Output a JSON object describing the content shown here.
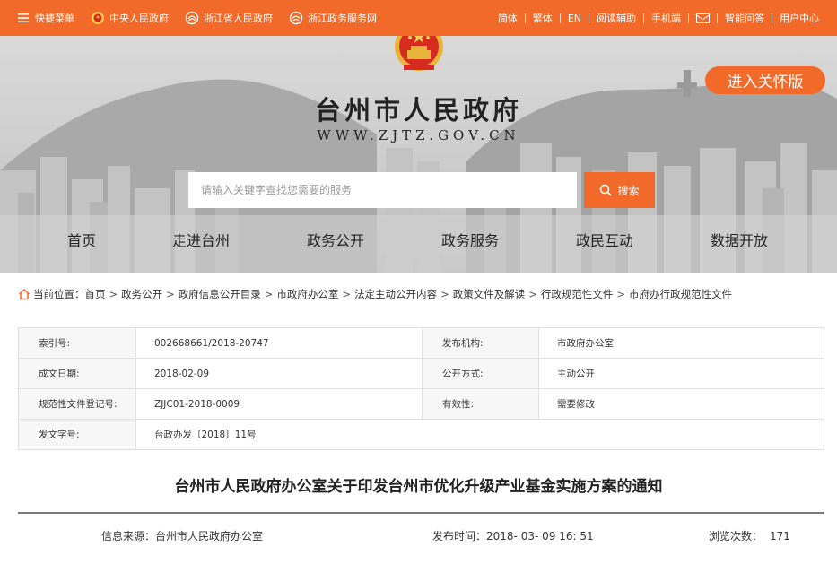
{
  "topbar": {
    "left": [
      {
        "label": "快捷菜单",
        "icon": "menu-icon"
      },
      {
        "label": "中央人民政府",
        "icon": "emblem-icon"
      },
      {
        "label": "浙江省人民政府",
        "icon": "zhejiang-logo-icon"
      },
      {
        "label": "浙江政务服务网",
        "icon": "service-logo-icon"
      }
    ],
    "right": [
      "简体",
      "繁体",
      "EN",
      "阅读辅助",
      "手机端",
      "",
      "智能问答",
      "用户中心"
    ]
  },
  "header": {
    "title": "台州市人民政府",
    "url": "WWW.ZJTZ.GOV.CN",
    "care_button": "进入关怀版"
  },
  "search": {
    "placeholder": "请输入关键字查找您需要的服务",
    "button": "搜索"
  },
  "nav": [
    "首页",
    "走进台州",
    "政务公开",
    "政务服务",
    "政民互动",
    "数据开放"
  ],
  "breadcrumb": {
    "prefix": "当前位置：",
    "items": [
      "首页",
      "政务公开",
      "政府信息公开目录",
      "市政府办公室",
      "法定主动公开内容",
      "政策文件及解读",
      "行政规范性文件",
      "市府办行政规范性文件"
    ]
  },
  "info": {
    "index_label": "索引号:",
    "index_value": "002668661/2018-20747",
    "issuer_label": "发布机构:",
    "issuer_value": "市政府办公室",
    "date_label": "成文日期:",
    "date_value": "2018-02-09",
    "mode_label": "公开方式:",
    "mode_value": "主动公开",
    "reg_label": "规范性文件登记号:",
    "reg_value": "ZJJC01-2018-0009",
    "validity_label": "有效性:",
    "validity_value": "需要修改",
    "docno_label": "发文字号:",
    "docno_value": "台政办发〔2018〕11号"
  },
  "article": {
    "title": "台州市人民政府办公室关于印发台州市优化升级产业基金实施方案的通知",
    "source_label": "信息来源：",
    "source_value": "台州市人民政府办公室",
    "time_label": "发布时间：",
    "time_value": "2018- 03- 09 16: 51",
    "views_label": "浏览次数：",
    "views_value": "171"
  },
  "colors": {
    "accent": "#f26a2a"
  }
}
